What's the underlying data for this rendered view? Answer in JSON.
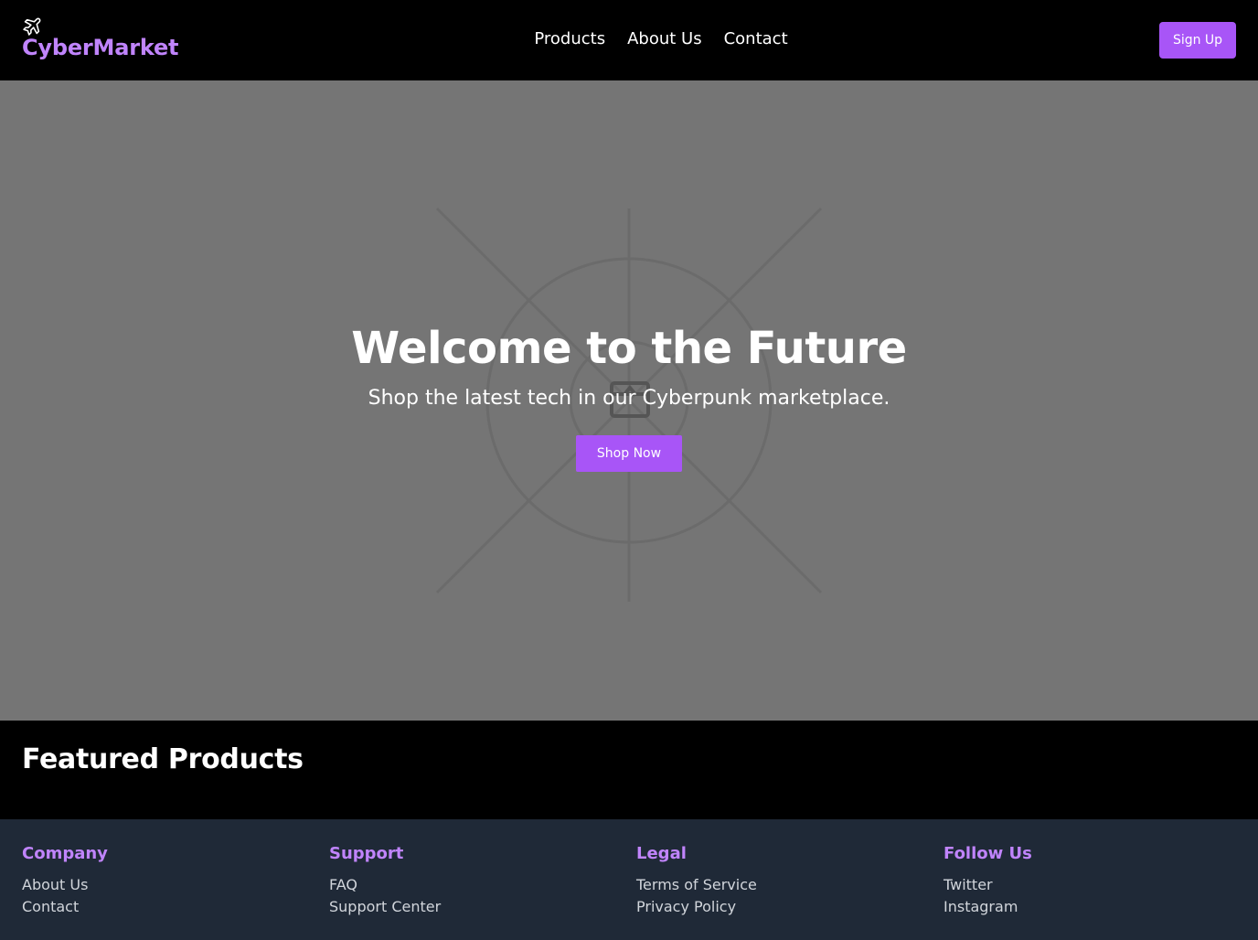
{
  "header": {
    "logo_icon": "airplane-icon",
    "brand": "CyberMarket",
    "nav": [
      "Products",
      "About Us",
      "Contact"
    ],
    "signup_label": "Sign Up"
  },
  "hero": {
    "placeholder_icon": "image-placeholder-icon",
    "title": "Welcome to the Future",
    "subtitle": "Shop the latest tech in our Cyberpunk marketplace.",
    "cta_label": "Shop Now"
  },
  "featured": {
    "title": "Featured Products"
  },
  "footer": {
    "columns": [
      {
        "title": "Company",
        "links": [
          "About Us",
          "Contact"
        ]
      },
      {
        "title": "Support",
        "links": [
          "FAQ",
          "Support Center"
        ]
      },
      {
        "title": "Legal",
        "links": [
          "Terms of Service",
          "Privacy Policy"
        ]
      },
      {
        "title": "Follow Us",
        "links": [
          "Twitter",
          "Instagram"
        ]
      }
    ]
  },
  "colors": {
    "accent": "#a855f7",
    "brand_text": "#c084fc",
    "hero_bg": "#757575",
    "footer_bg": "#1f2937",
    "header_bg": "#000000"
  }
}
